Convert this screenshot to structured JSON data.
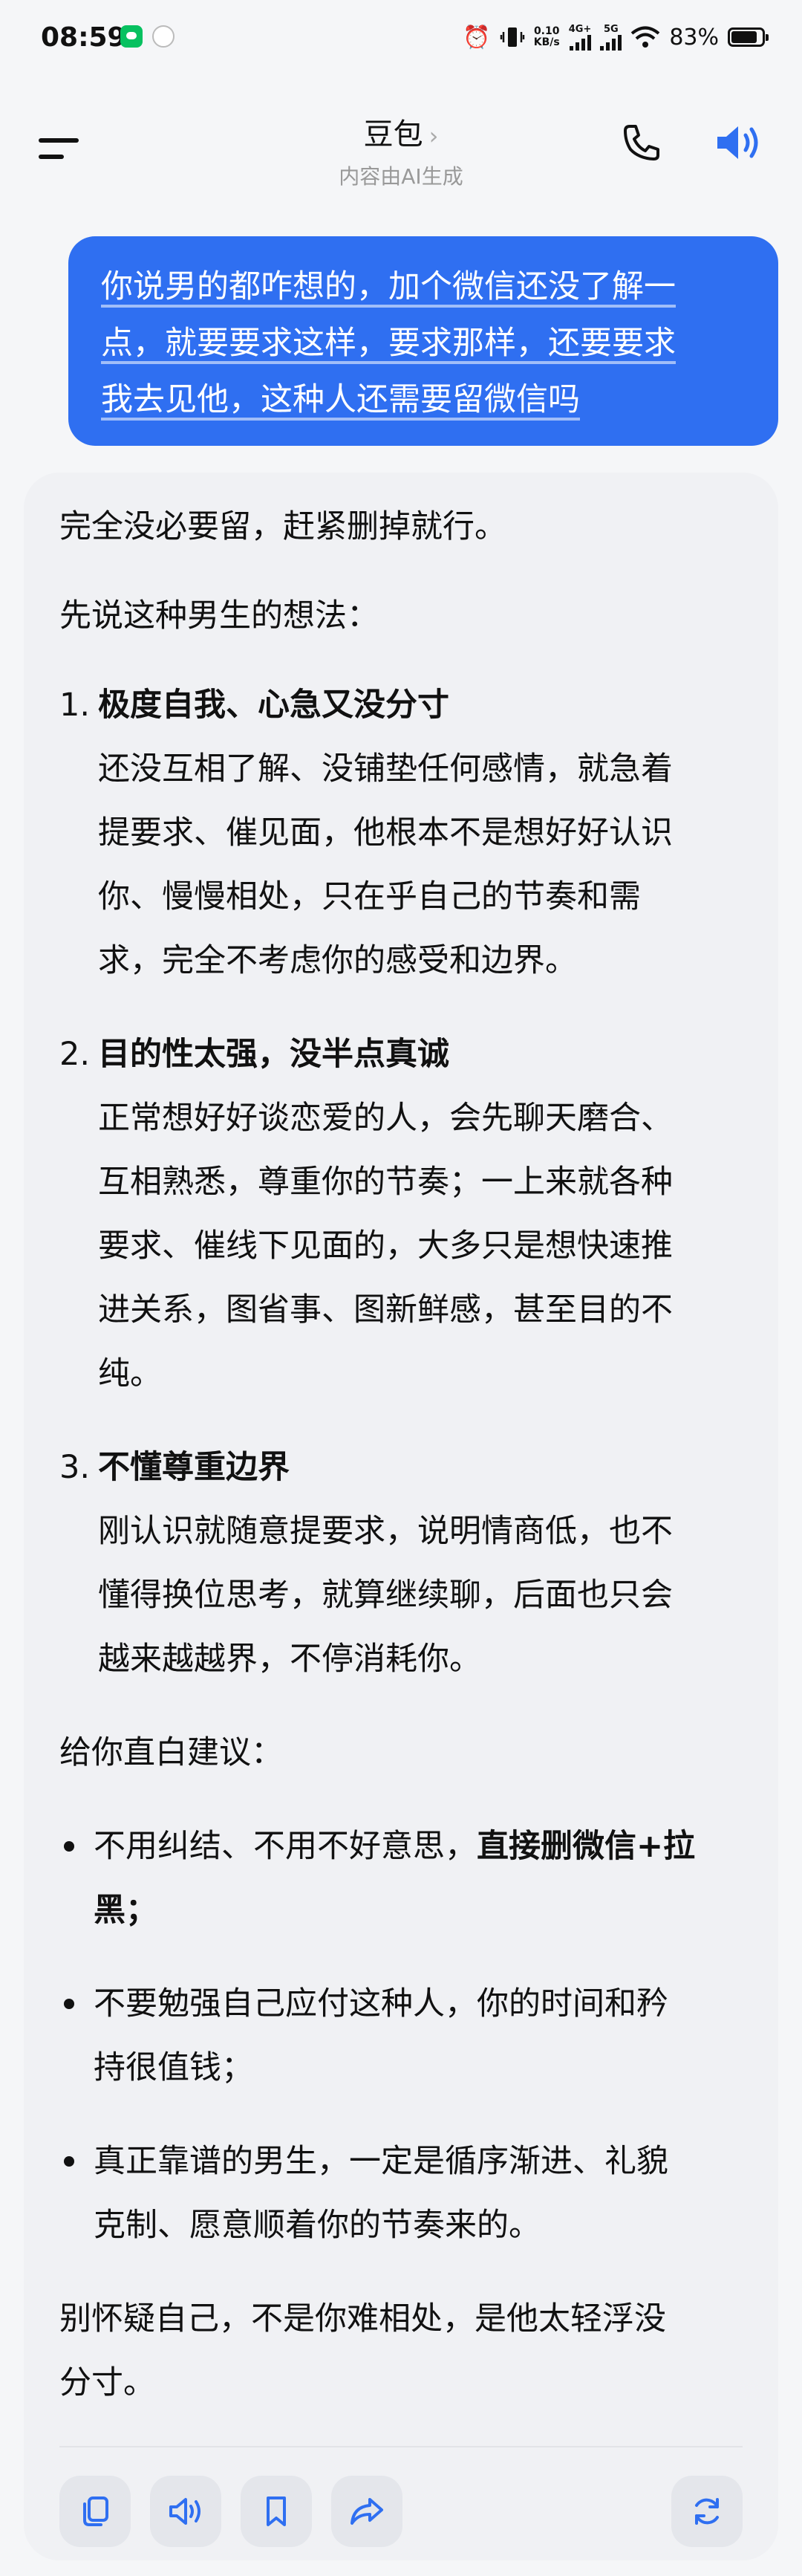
{
  "status_bar": {
    "time": "08:59",
    "net_speed_value": "0.10",
    "net_speed_unit": "KB/s",
    "sim1_label": "4G+",
    "sim2_label": "5G",
    "battery": "83%"
  },
  "header": {
    "title": "豆包",
    "title_chevron": "›",
    "subtitle": "内容由AI生成"
  },
  "user_message": {
    "lines": [
      "你说男的都咋想的，加个微信还没了解一",
      "点，就要要求这样，要求那样，还要要求",
      "我去见他，这种人还需要留微信吗"
    ]
  },
  "answer": {
    "intro": "完全没必要留，赶紧删掉就行。",
    "section_title": "先说这种男生的想法：",
    "points": [
      {
        "number": "1.",
        "title": "极度自我、心急又没分寸",
        "lines": [
          "还没互相了解、没铺垫任何感情，就急着",
          "提要求、催见面，他根本不是想好好认识",
          "你、慢慢相处，只在乎自己的节奏和需",
          "求，完全不考虑你的感受和边界。"
        ]
      },
      {
        "number": "2.",
        "title": "目的性太强，没半点真诚",
        "lines": [
          "正常想好好谈恋爱的人，会先聊天磨合、",
          "互相熟悉，尊重你的节奏；一上来就各种",
          "要求、催线下见面的，大多只是想快速推",
          "进关系，图省事、图新鲜感，甚至目的不",
          "纯。"
        ]
      },
      {
        "number": "3.",
        "title": "不懂尊重边界",
        "lines": [
          "刚认识就随意提要求，说明情商低，也不",
          "懂得换位思考，就算继续聊，后面也只会",
          "越来越越界，不停消耗你。"
        ]
      }
    ],
    "advice_title": "给你直白建议：",
    "bullet1_plain": "不用纠结、不用不好意思，",
    "bullet1_bold_a": "直接删微信+拉",
    "bullet1_bold_b": "黑；",
    "bullet2_lines": [
      "不要勉强自己应付这种人，你的时间和矜",
      "持很值钱；"
    ],
    "bullet3_lines": [
      "真正靠谱的男生，一定是循序渐进、礼貌",
      "克制、愿意顺着你的节奏来的。"
    ],
    "closing_lines": [
      "别怀疑自己，不是你难相处，是他太轻浮没",
      "分寸。"
    ]
  },
  "actions": {
    "icons": [
      "copy-icon",
      "read-aloud-icon",
      "bookmark-icon",
      "share-icon",
      "regenerate-icon"
    ]
  },
  "colors": {
    "accent": "#2f6ff1",
    "bubble_text": "#ffffff",
    "card_bg": "#f0f1f4",
    "page_bg": "#f5f6f8"
  }
}
